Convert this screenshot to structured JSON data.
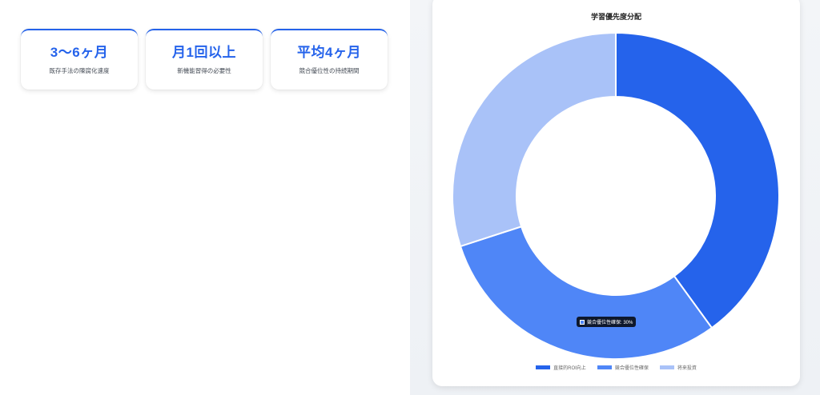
{
  "stats": [
    {
      "value": "3〜6ヶ月",
      "label": "既存手法の陳腐化速度"
    },
    {
      "value": "月1回以上",
      "label": "新機能習得の必要性"
    },
    {
      "value": "平均4ヶ月",
      "label": "競合優位性の持続期間"
    }
  ],
  "tooltip": {
    "text": "競合優位性確保: 30%",
    "color": "#4f86f7"
  },
  "chart_data": {
    "type": "pie",
    "title": "学習優先度分配",
    "variant": "doughnut",
    "categories": [
      "直接的ROI向上",
      "競合優位性確保",
      "将来投資"
    ],
    "values": [
      40,
      30,
      30
    ],
    "unit": "%",
    "colors": [
      "#2563eb",
      "#4f86f7",
      "#a9c2f8"
    ],
    "legend": "bottom"
  }
}
